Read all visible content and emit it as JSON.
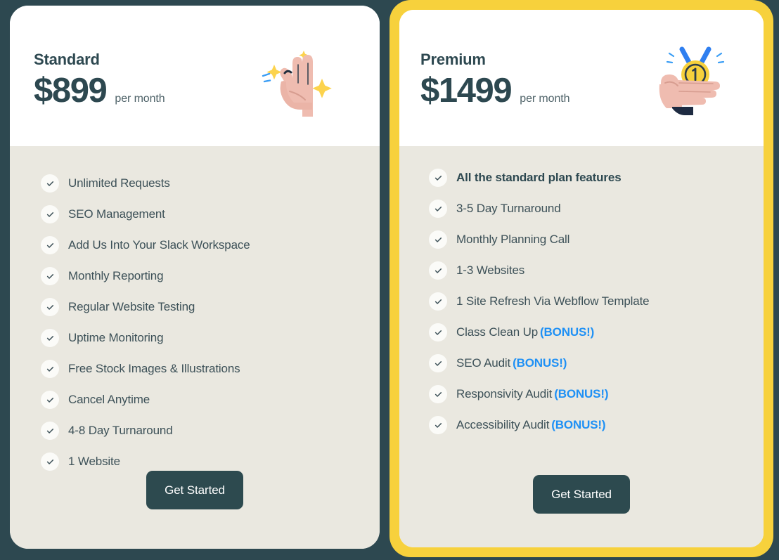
{
  "theme": {
    "page_background": "#2d4850",
    "card_background": "#ffffff",
    "feature_background": "#eae8e0",
    "highlight_border": "#f7d13c",
    "button_background": "#2d4a4f",
    "button_text": "#ffffff",
    "bonus_accent": "#1e90f5",
    "text_primary": "#2d4850",
    "text_secondary": "#3d5158"
  },
  "plans": [
    {
      "id": "standard",
      "name": "Standard",
      "price": "$899",
      "period": "per month",
      "illustration": "ok-hand-sparkles-icon",
      "highlighted": false,
      "features": [
        {
          "text": "Unlimited Requests",
          "bold": false,
          "bonus": ""
        },
        {
          "text": "SEO Management",
          "bold": false,
          "bonus": ""
        },
        {
          "text": "Add Us Into Your Slack Workspace",
          "bold": false,
          "bonus": ""
        },
        {
          "text": "Monthly Reporting",
          "bold": false,
          "bonus": ""
        },
        {
          "text": "Regular Website Testing",
          "bold": false,
          "bonus": ""
        },
        {
          "text": "Uptime Monitoring",
          "bold": false,
          "bonus": ""
        },
        {
          "text": "Free Stock Images & Illustrations",
          "bold": false,
          "bonus": ""
        },
        {
          "text": "Cancel Anytime",
          "bold": false,
          "bonus": ""
        },
        {
          "text": "4-8 Day Turnaround",
          "bold": false,
          "bonus": ""
        },
        {
          "text": "1 Website",
          "bold": false,
          "bonus": ""
        }
      ],
      "cta_label": "Get Started"
    },
    {
      "id": "premium",
      "name": "Premium",
      "price": "$1499",
      "period": "per month",
      "illustration": "hand-gold-medal-icon",
      "highlighted": true,
      "features": [
        {
          "text": "All the standard plan features",
          "bold": true,
          "bonus": ""
        },
        {
          "text": "3-5 Day Turnaround",
          "bold": false,
          "bonus": ""
        },
        {
          "text": "Monthly Planning Call",
          "bold": false,
          "bonus": ""
        },
        {
          "text": "1-3 Websites",
          "bold": false,
          "bonus": ""
        },
        {
          "text": "1 Site Refresh Via Webflow Template",
          "bold": false,
          "bonus": ""
        },
        {
          "text": "Class Clean Up",
          "bold": false,
          "bonus": "(BONUS!)"
        },
        {
          "text": "SEO Audit",
          "bold": false,
          "bonus": "(BONUS!)"
        },
        {
          "text": "Responsivity Audit",
          "bold": false,
          "bonus": "(BONUS!)"
        },
        {
          "text": "Accessibility Audit",
          "bold": false,
          "bonus": "(BONUS!)"
        }
      ],
      "cta_label": "Get Started"
    }
  ]
}
